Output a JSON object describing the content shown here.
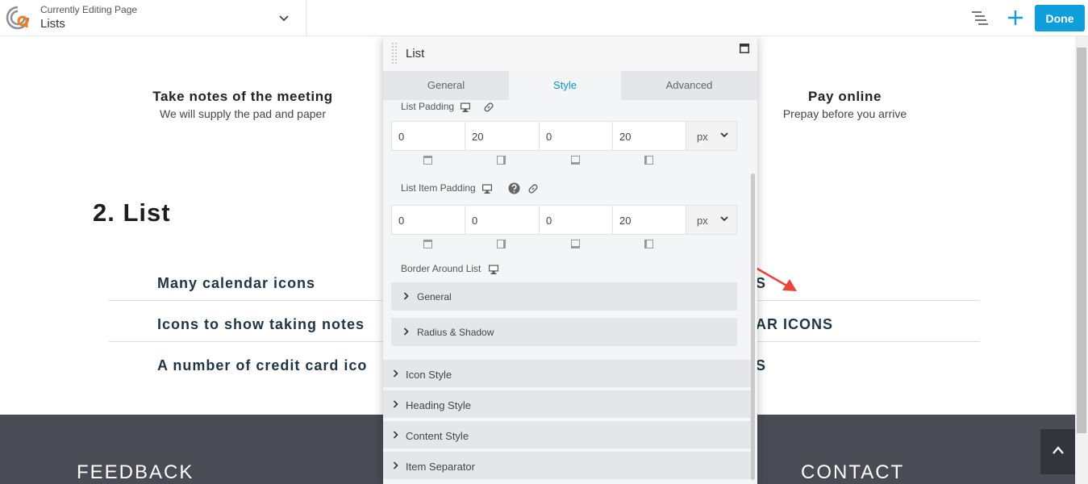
{
  "topbar": {
    "subtitle": "Currently Editing Page",
    "page_name": "Lists",
    "done_label": "Done",
    "accent": "#0e9edb"
  },
  "page": {
    "feature_left": {
      "title": "Take notes of the meeting",
      "text": "We will supply the pad and paper"
    },
    "feature_right": {
      "title": "Pay online",
      "text": "Prepay before you arrive"
    },
    "section_heading": "2. List",
    "list_left": [
      "Many calendar icons",
      "Icons to show taking notes",
      "A number of credit card ico"
    ],
    "list_right": [
      "S",
      "AR ICONS",
      "S"
    ]
  },
  "footer": {
    "left_heading": "FEEDBACK",
    "right_heading": "CONTACT"
  },
  "panel": {
    "title": "List",
    "tabs": [
      "General",
      "Style",
      "Advanced"
    ],
    "active_tab": "Style",
    "list_padding": {
      "label": "List Padding",
      "values": [
        "0",
        "20",
        "0",
        "20"
      ],
      "unit": "px"
    },
    "list_item_padding": {
      "label": "List Item Padding",
      "values": [
        "0",
        "0",
        "0",
        "20"
      ],
      "unit": "px"
    },
    "border_label": "Border Around List",
    "border_sections": [
      "General",
      "Radius & Shadow"
    ],
    "sections": [
      "Icon Style",
      "Heading Style",
      "Content Style",
      "Item Separator"
    ]
  },
  "colors": {
    "annotation_arrow": "#e8453c",
    "footer_bg": "#4a4c55",
    "tab_active": "#0e90d2"
  }
}
